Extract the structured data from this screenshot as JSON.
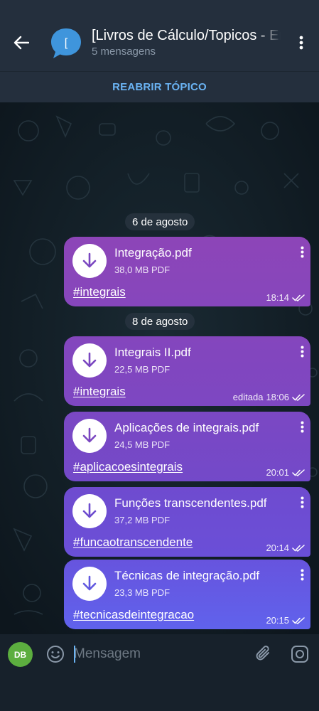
{
  "header": {
    "title": "[Livros de Cálculo/Topicos - Em",
    "subtitle": "5 mensagens",
    "avatar_letter": "["
  },
  "reopen": {
    "label": "REABRIR TÓPICO"
  },
  "dates": [
    "6 de agosto",
    "8 de agosto"
  ],
  "messages": [
    {
      "file_name": "Integração.pdf",
      "file_size": "38,0 MB PDF",
      "hashtag": "#integrais",
      "time": "18:14",
      "edited": ""
    },
    {
      "file_name": "Integrais II.pdf",
      "file_size": "22,5 MB PDF",
      "hashtag": "#integrais",
      "time": "18:06",
      "edited": "editada"
    },
    {
      "file_name": "Aplicações de integrais.pdf",
      "file_size": "24,5 MB PDF",
      "hashtag": "#aplicacoesintegrais",
      "time": "20:01",
      "edited": ""
    },
    {
      "file_name": "Funções transcendentes.pdf",
      "file_size": "37,2 MB PDF",
      "hashtag": "#funcaotranscendente",
      "time": "20:14",
      "edited": ""
    },
    {
      "file_name": "Técnicas de integração.pdf",
      "file_size": "23,3 MB PDF",
      "hashtag": "#tecnicasdeintegracao",
      "time": "20:15",
      "edited": ""
    }
  ],
  "input": {
    "placeholder": "Mensagem",
    "avatar_initials": "DB"
  },
  "colors": {
    "header_bg": "#242f3d",
    "accent": "#6ab3f3",
    "bubble_gradient_top": "#8e44b5",
    "bubble_gradient_bottom": "#6366ec",
    "avatar_green": "#5cae3f"
  },
  "icons": {
    "back": "arrow-left-icon",
    "menu": "more-vertical-icon",
    "file": "download-icon",
    "status": "double-check-icon",
    "emoji": "smile-icon",
    "attach": "paperclip-icon",
    "camera": "camera-icon"
  }
}
